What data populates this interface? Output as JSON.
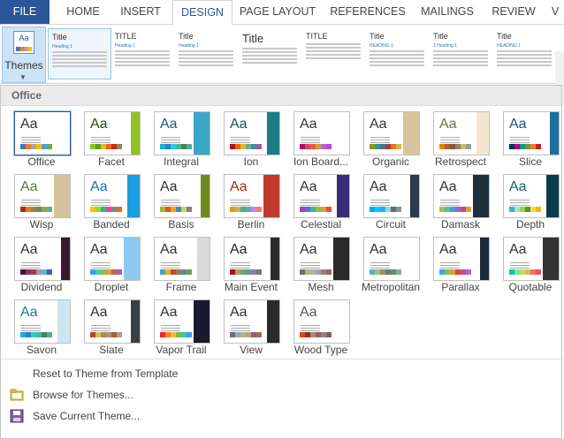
{
  "ribbon": {
    "tabs": [
      "FILE",
      "HOME",
      "INSERT",
      "DESIGN",
      "PAGE LAYOUT",
      "REFERENCES",
      "MAILINGS",
      "REVIEW",
      "V"
    ],
    "active_tab": "DESIGN",
    "themes_button_label": "Themes",
    "style_gallery": [
      {
        "title": "Title",
        "heading": "Heading 1"
      },
      {
        "title": "TITLE",
        "heading": "Heading 1"
      },
      {
        "title": "Title",
        "heading": "Heading 1"
      },
      {
        "title": "Title",
        "heading": ""
      },
      {
        "title": "TITLE",
        "heading": ""
      },
      {
        "title": "Title",
        "heading": "HEADING 1"
      },
      {
        "title": "Title",
        "heading": "1 Heading 1"
      },
      {
        "title": "Title",
        "heading": "HEADING 1"
      }
    ]
  },
  "panel": {
    "section_label": "Office",
    "themes": [
      {
        "name": "Office",
        "accent": "#4472c4",
        "deco": "",
        "aa_color": "#333333",
        "swatches": [
          "#4472c4",
          "#ed7d31",
          "#a5a5a5",
          "#ffc000",
          "#5b9bd5",
          "#70ad47"
        ]
      },
      {
        "name": "Facet",
        "accent": "#90c226",
        "deco": "#90c226",
        "aa_color": "#2a4a1a",
        "swatches": [
          "#90c226",
          "#54a021",
          "#e6b91e",
          "#e76618",
          "#c42f1a",
          "#918655"
        ]
      },
      {
        "name": "Integral",
        "accent": "#1cade4",
        "deco": "#3aa6c8",
        "aa_color": "#1c5b7a",
        "swatches": [
          "#1cade4",
          "#2683c6",
          "#27ced7",
          "#42ba97",
          "#3e8853",
          "#62a39f"
        ]
      },
      {
        "name": "Ion",
        "accent": "#b01513",
        "deco": "#1e7c84",
        "aa_color": "#1e4f55",
        "swatches": [
          "#b01513",
          "#ea6312",
          "#e6b729",
          "#6aac90",
          "#54849a",
          "#9e5e9b"
        ]
      },
      {
        "name": "Ion Board...",
        "accent": "#b31166",
        "deco": "#ffffff",
        "aa_color": "#333333",
        "swatches": [
          "#b31166",
          "#e33d6f",
          "#e45f3c",
          "#e9943a",
          "#9b6bf2",
          "#d53dd0"
        ]
      },
      {
        "name": "Organic",
        "accent": "#83992a",
        "deco": "#d9c39a",
        "aa_color": "#333333",
        "swatches": [
          "#83992a",
          "#3c9770",
          "#44709d",
          "#a23c33",
          "#d97828",
          "#deb340"
        ]
      },
      {
        "name": "Retrospect",
        "accent": "#e48312",
        "deco": "#f2e6cf",
        "aa_color": "#637052",
        "swatches": [
          "#e48312",
          "#bd582c",
          "#865640",
          "#9b8357",
          "#c2bc80",
          "#94a088"
        ]
      },
      {
        "name": "Slice",
        "accent": "#052f61",
        "deco": "#1d6f9e",
        "aa_color": "#1d4f7a",
        "swatches": [
          "#052f61",
          "#a50e82",
          "#14967c",
          "#6a9e1f",
          "#e87d37",
          "#c62324"
        ]
      },
      {
        "name": "Wisp",
        "accent": "#a53010",
        "deco": "#d4c39a",
        "aa_color": "#5a7a3a",
        "swatches": [
          "#a53010",
          "#de7e18",
          "#9f8351",
          "#728653",
          "#92aa4c",
          "#6aac91"
        ]
      },
      {
        "name": "Banded",
        "accent": "#ffc000",
        "deco": "#1c9de0",
        "aa_color": "#1c6fa0",
        "swatches": [
          "#ffc000",
          "#a5d028",
          "#08cc78",
          "#f24099",
          "#828288",
          "#f56617"
        ]
      },
      {
        "name": "Basis",
        "accent": "#a6b727",
        "deco": "#6e8a1e",
        "aa_color": "#333333",
        "swatches": [
          "#a6b727",
          "#df5327",
          "#fe9e00",
          "#418ab3",
          "#d7d447",
          "#818183"
        ]
      },
      {
        "name": "Berlin",
        "accent": "#f09415",
        "deco": "#c0392b",
        "aa_color": "#9b2d1f",
        "swatches": [
          "#f09415",
          "#c1b56b",
          "#4baf73",
          "#5aa6c0",
          "#d17df9",
          "#fa7e5c"
        ]
      },
      {
        "name": "Celestial",
        "accent": "#ac3ec1",
        "deco": "#3a2a7a",
        "aa_color": "#333333",
        "swatches": [
          "#ac3ec1",
          "#477bd1",
          "#46b298",
          "#90ba4c",
          "#dd9d31",
          "#e25247"
        ]
      },
      {
        "name": "Circuit",
        "accent": "#00a6ff",
        "deco": "#2c3a4a",
        "aa_color": "#333333",
        "swatches": [
          "#00a6ff",
          "#00ccff",
          "#1ab3f3",
          "#95d5e6",
          "#5c6c7c",
          "#8f8f8f"
        ]
      },
      {
        "name": "Damask",
        "accent": "#9ec544",
        "deco": "#1a2f3a",
        "aa_color": "#333333",
        "swatches": [
          "#9ec544",
          "#50bea3",
          "#4a9ccc",
          "#9a66ca",
          "#c54f71",
          "#de9c3c"
        ]
      },
      {
        "name": "Depth",
        "accent": "#41aebd",
        "deco": "#0b3b48",
        "aa_color": "#1b5f6a",
        "swatches": [
          "#41aebd",
          "#97e9d5",
          "#a2cf49",
          "#608f3d",
          "#f4de3a",
          "#fcb11c"
        ]
      },
      {
        "name": "Dividend",
        "accent": "#4d1434",
        "deco": "#3a1a2a",
        "aa_color": "#333333",
        "swatches": [
          "#4d1434",
          "#903163",
          "#b2324b",
          "#969fa7",
          "#66b1ce",
          "#40619d"
        ]
      },
      {
        "name": "Droplet",
        "accent": "#2fa3ee",
        "deco": "#8fc9f2",
        "aa_color": "#333333",
        "swatches": [
          "#2fa3ee",
          "#4bcaad",
          "#86c157",
          "#d99c3f",
          "#ce6633",
          "#a35dd1"
        ]
      },
      {
        "name": "Frame",
        "accent": "#40a7c2",
        "deco": "#d9d9d9",
        "aa_color": "#333333",
        "swatches": [
          "#40a7c2",
          "#e2b12a",
          "#bb4e2b",
          "#8f7d4d",
          "#5c88b1",
          "#7b9c4a"
        ]
      },
      {
        "name": "Main Event",
        "accent": "#b80e0f",
        "deco": "#2b2b2b",
        "aa_color": "#222222",
        "swatches": [
          "#b80e0f",
          "#a6987d",
          "#7f9a71",
          "#64969f",
          "#9b75b2",
          "#80737a"
        ]
      },
      {
        "name": "Mesh",
        "accent": "#6f6f74",
        "deco": "#2a2a2a",
        "aa_color": "#333333",
        "swatches": [
          "#6f6f74",
          "#a7b789",
          "#beae98",
          "#92a9b9",
          "#9c8265",
          "#8d6974"
        ]
      },
      {
        "name": "Metropolitan",
        "accent": "#50b4c8",
        "deco": "#ffffff",
        "aa_color": "#333333",
        "swatches": [
          "#50b4c8",
          "#a8b97f",
          "#9b9256",
          "#657689",
          "#7a855d",
          "#84ac9d"
        ]
      },
      {
        "name": "Parallax",
        "accent": "#30acec",
        "deco": "#1a2a3a",
        "aa_color": "#333333",
        "swatches": [
          "#30acec",
          "#80c34f",
          "#e29d3e",
          "#d64a3b",
          "#d64787",
          "#a666e1"
        ]
      },
      {
        "name": "Quotable",
        "accent": "#00c6bb",
        "deco": "#333333",
        "aa_color": "#333333",
        "swatches": [
          "#00c6bb",
          "#6feba0",
          "#b6df5e",
          "#efb251",
          "#ef755f",
          "#ed515c"
        ]
      },
      {
        "name": "Savon",
        "accent": "#1cade4",
        "deco": "#cfe6f2",
        "aa_color": "#1c7aa0",
        "swatches": [
          "#1cade4",
          "#2683c6",
          "#27ced7",
          "#42ba97",
          "#3e8853",
          "#62a39f"
        ]
      },
      {
        "name": "Slate",
        "accent": "#bc451b",
        "deco": "#3a3f44",
        "aa_color": "#333333",
        "swatches": [
          "#bc451b",
          "#d3ba68",
          "#bb8640",
          "#ad9277",
          "#a55a43",
          "#ad9d7b"
        ]
      },
      {
        "name": "Vapor Trail",
        "accent": "#df2e28",
        "deco": "#1a1a2e",
        "aa_color": "#333333",
        "swatches": [
          "#df2e28",
          "#fe801a",
          "#e9bf35",
          "#81bb42",
          "#32c7a9",
          "#4a9bdc"
        ]
      },
      {
        "name": "View",
        "accent": "#6f6f74",
        "deco": "#2a2a2a",
        "aa_color": "#333333",
        "swatches": [
          "#6f6f74",
          "#92a9b9",
          "#a7b789",
          "#b9a489",
          "#8d6374",
          "#9b7362"
        ]
      },
      {
        "name": "Wood Type",
        "accent": "#d34817",
        "deco": "",
        "aa_color": "#555555",
        "swatches": [
          "#d34817",
          "#9b2d1f",
          "#a28e6a",
          "#956251",
          "#918485",
          "#855d5d"
        ]
      }
    ],
    "commands": [
      {
        "label": "Reset to Theme from Template",
        "icon": ""
      },
      {
        "label": "Browse for Themes...",
        "icon": "folder-icon"
      },
      {
        "label": "Save Current Theme...",
        "icon": "save-theme-icon"
      }
    ]
  }
}
